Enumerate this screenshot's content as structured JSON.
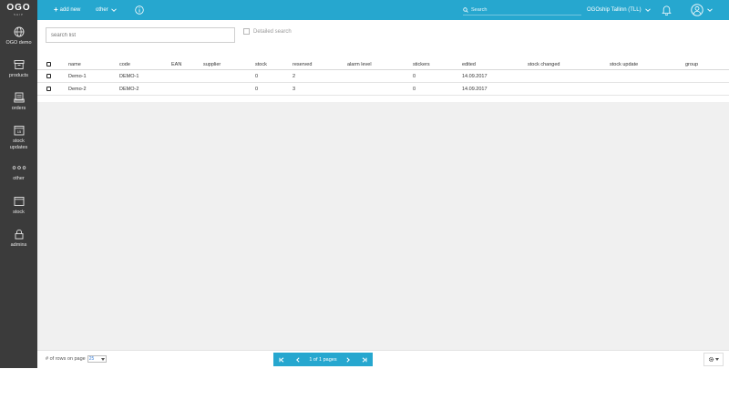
{
  "logo": {
    "text": "OGO",
    "sub": "SHIP"
  },
  "sidebar": {
    "items": [
      {
        "label": "OGO demo",
        "icon": "globe-icon"
      },
      {
        "label": "products",
        "icon": "box-icon"
      },
      {
        "label": "orders",
        "icon": "orders-icon"
      },
      {
        "label": "stock updates",
        "icon": "calendar-icon"
      },
      {
        "label": "other",
        "icon": "dots-icon"
      },
      {
        "label": "stock",
        "icon": "window-icon"
      },
      {
        "label": "admins",
        "icon": "lock-icon"
      }
    ]
  },
  "topbar": {
    "add_new": "add new",
    "other": "other",
    "search_placeholder": "Search",
    "account": "OGOship Tallinn (TLL)"
  },
  "filters": {
    "search_placeholder": "search list",
    "detailed_search": "Detailed search"
  },
  "table": {
    "columns": [
      "name",
      "code",
      "EAN",
      "supplier",
      "stock",
      "reserved",
      "alarm level",
      "stickers",
      "edited",
      "stock changed",
      "stock update",
      "group"
    ],
    "rows": [
      {
        "name": "Demo-1",
        "code": "DEMO-1",
        "ean": "",
        "supplier": "",
        "stock": "0",
        "reserved": "2",
        "alarm": "",
        "stickers": "0",
        "edited": "14.09.2017",
        "stock_changed": "",
        "stock_update": "",
        "group": ""
      },
      {
        "name": "Demo-2",
        "code": "DEMO-2",
        "ean": "",
        "supplier": "",
        "stock": "0",
        "reserved": "3",
        "alarm": "",
        "stickers": "0",
        "edited": "14.09.2017",
        "stock_changed": "",
        "stock_update": "",
        "group": ""
      }
    ]
  },
  "footer": {
    "rows_label": "# of rows on page",
    "rows_value": "25",
    "pager_text": "1 of 1 pages"
  },
  "colors": {
    "accent": "#26a7cf",
    "sidebar": "#3b3b3b",
    "main_bg": "#f0f0f0"
  }
}
